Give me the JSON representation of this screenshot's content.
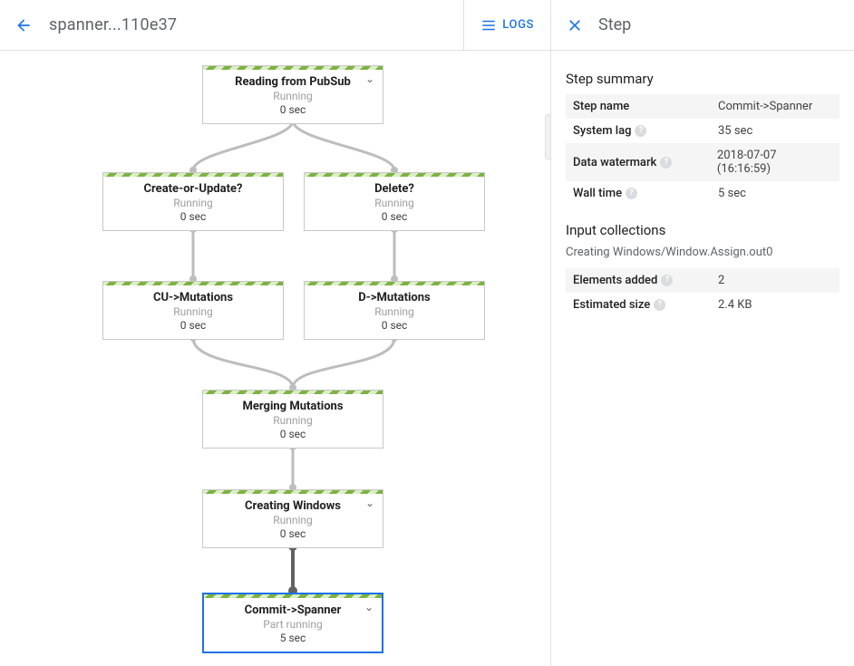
{
  "header": {
    "job_title": "spanner...110e37",
    "logs_button": "LOGS",
    "panel_title": "Step"
  },
  "graph": {
    "nodes": [
      {
        "id": "read_pubsub",
        "name": "Reading from PubSub",
        "status": "Running",
        "time": "0 sec",
        "expandable": true,
        "selected": false
      },
      {
        "id": "create_or_update",
        "name": "Create-or-Update?",
        "status": "Running",
        "time": "0 sec",
        "expandable": false,
        "selected": false
      },
      {
        "id": "delete",
        "name": "Delete?",
        "status": "Running",
        "time": "0 sec",
        "expandable": false,
        "selected": false
      },
      {
        "id": "cu_mutations",
        "name": "CU->Mutations",
        "status": "Running",
        "time": "0 sec",
        "expandable": false,
        "selected": false
      },
      {
        "id": "d_mutations",
        "name": "D->Mutations",
        "status": "Running",
        "time": "0 sec",
        "expandable": false,
        "selected": false
      },
      {
        "id": "merging",
        "name": "Merging Mutations",
        "status": "Running",
        "time": "0 sec",
        "expandable": false,
        "selected": false
      },
      {
        "id": "creating_windows",
        "name": "Creating Windows",
        "status": "Running",
        "time": "0 sec",
        "expandable": true,
        "selected": false
      },
      {
        "id": "commit_spanner",
        "name": "Commit->Spanner",
        "status": "Part running",
        "time": "5 sec",
        "expandable": true,
        "selected": true
      }
    ]
  },
  "step_panel": {
    "summary_title": "Step summary",
    "rows": {
      "step_name": {
        "label": "Step name",
        "value": "Commit->Spanner"
      },
      "system_lag": {
        "label": "System lag",
        "value": "35 sec"
      },
      "data_watermark": {
        "label": "Data watermark",
        "value": "2018-07-07 (16:16:59)"
      },
      "wall_time": {
        "label": "Wall time",
        "value": "5 sec"
      }
    },
    "input_collections_title": "Input collections",
    "input_collections_sub": "Creating Windows/Window.Assign.out0",
    "input_rows": {
      "elements_added": {
        "label": "Elements added",
        "value": "2"
      },
      "estimated_size": {
        "label": "Estimated size",
        "value": "2.4 KB"
      }
    }
  }
}
